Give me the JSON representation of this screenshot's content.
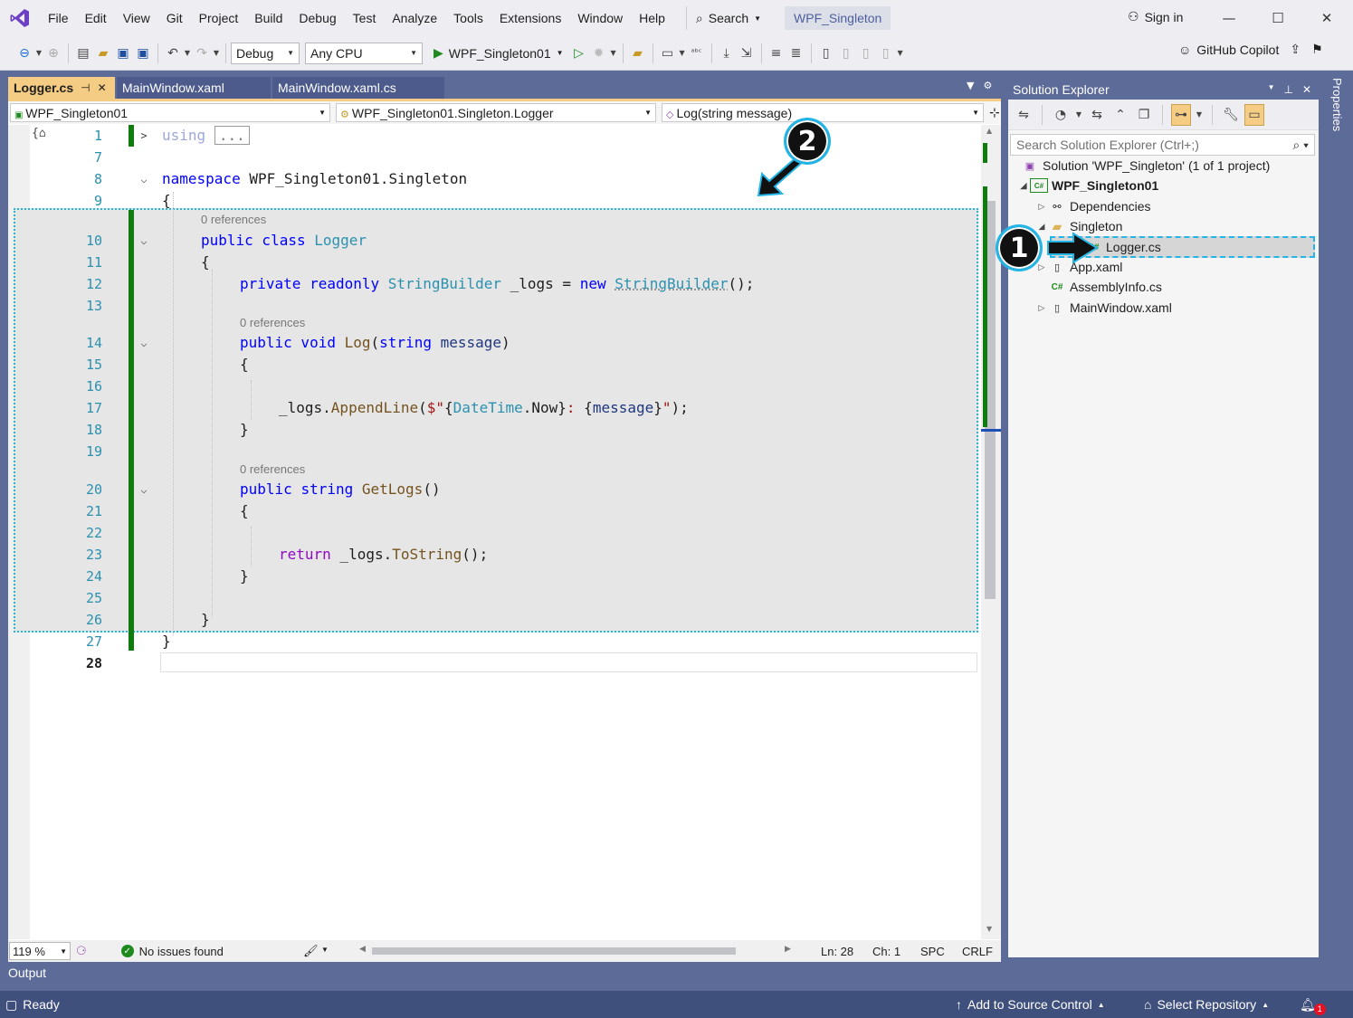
{
  "menu": {
    "items": [
      "File",
      "Edit",
      "View",
      "Git",
      "Project",
      "Build",
      "Debug",
      "Test",
      "Analyze",
      "Tools",
      "Extensions",
      "Window",
      "Help"
    ],
    "search_label": "Search",
    "solution_name": "WPF_Singleton",
    "sign_in": "Sign in"
  },
  "toolbar": {
    "configuration": "Debug",
    "platform": "Any CPU",
    "run_target": "WPF_Singleton01",
    "copilot": "GitHub Copilot"
  },
  "doc_tabs": [
    {
      "label": "Logger.cs",
      "active": true
    },
    {
      "label": "MainWindow.xaml",
      "active": false
    },
    {
      "label": "MainWindow.xaml.cs",
      "active": false
    }
  ],
  "nav_bar": {
    "project": "WPF_Singleton01",
    "type": "WPF_Singleton01.Singleton.Logger",
    "member": "Log(string message)"
  },
  "code": {
    "line_numbers": [
      "1",
      "7",
      "8",
      "9",
      "10",
      "11",
      "12",
      "13",
      "14",
      "15",
      "16",
      "17",
      "18",
      "19",
      "20",
      "21",
      "22",
      "23",
      "24",
      "25",
      "26",
      "27",
      "28"
    ],
    "using_kw": "using",
    "collapsed": "...",
    "namespace_kw": "namespace",
    "namespace_name": "WPF_Singleton01.Singleton",
    "open_brace": "{",
    "close_brace": "}",
    "codelens_text": "0 references",
    "class_kw": "public class",
    "class_name": "Logger",
    "field_mods": "private readonly",
    "field_type": "StringBuilder",
    "field_name": " _logs = ",
    "new_kw": "new",
    "field_ctor": "StringBuilder",
    "field_end": "();",
    "log_mods": "public void",
    "log_name": "Log",
    "log_param_type": "string",
    "log_param_name": "message",
    "append_prefix": "_logs.",
    "append_method": "AppendLine",
    "append_open": "(",
    "interp_start": "$\"",
    "interp_b1": "{",
    "datetime": "DateTime",
    "now": ".Now",
    "interp_b2": "}",
    "interp_mid": ": ",
    "interp_b3": "{",
    "interp_msg": "message",
    "interp_b4": "}",
    "interp_end": "\"",
    "append_close": ");",
    "getlogs_mods": "public",
    "getlogs_type": "string",
    "getlogs_name": "GetLogs",
    "getlogs_parens": "()",
    "return_kw": "return",
    "return_expr": " _logs.",
    "tostring": "ToString",
    "return_end": "();"
  },
  "editor_status": {
    "zoom": "119 %",
    "issues": "No issues found",
    "line": "Ln: 28",
    "char": "Ch: 1",
    "whitespace": "SPC",
    "line_ending": "CRLF"
  },
  "solution_explorer": {
    "title": "Solution Explorer",
    "search_placeholder": "Search Solution Explorer (Ctrl+;)",
    "solution": "Solution 'WPF_Singleton' (1 of 1 project)",
    "project": "WPF_Singleton01",
    "dependencies": "Dependencies",
    "folder": "Singleton",
    "selected_file": "Logger.cs",
    "app_xaml": "App.xaml",
    "assembly_info": "AssemblyInfo.cs",
    "main_window": "MainWindow.xaml",
    "cs_badge": "C#"
  },
  "properties_tab": "Properties",
  "output_label": "Output",
  "status_bar": {
    "ready": "Ready",
    "source_control": "Add to Source Control",
    "repository": "Select Repository",
    "notification_count": "1"
  },
  "callouts": {
    "one": "1",
    "two": "2"
  },
  "colors": {
    "accent_tab": "#f5cc84",
    "frame": "#5d6b99",
    "status_bar": "#40507d",
    "callout_border": "#22b5e6",
    "change_bar": "#107c10"
  }
}
